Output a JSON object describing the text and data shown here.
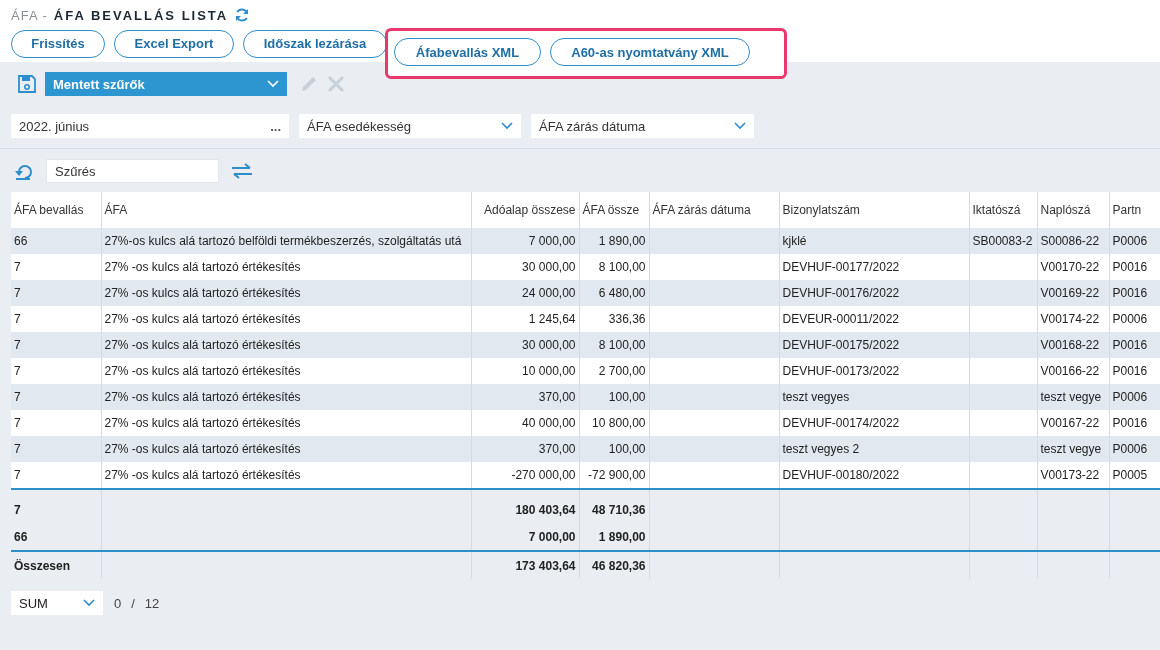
{
  "header": {
    "breadcrumb": "ÁFA -",
    "title": "ÁFA BEVALLÁS LISTA"
  },
  "toolbar": [
    {
      "label": "Frissítés",
      "highlighted": false
    },
    {
      "label": "Excel Export",
      "highlighted": false
    },
    {
      "label": "Időszak lezárása",
      "highlighted": false
    },
    {
      "label": "Áfabevallás XML",
      "highlighted": true
    },
    {
      "label": "A60-as nyomtatvány XML",
      "highlighted": true
    }
  ],
  "saved_filters": {
    "value": "Mentett szűrők"
  },
  "filters": [
    {
      "kind": "period",
      "value": "2022. június",
      "button": "..."
    },
    {
      "kind": "select",
      "value": "ÁFA esedékesség"
    },
    {
      "kind": "select",
      "value": "ÁFA zárás dátuma"
    }
  ],
  "search": {
    "placeholder": "Szűrés"
  },
  "table": {
    "columns": [
      "ÁFA bevallás",
      "ÁFA",
      "Adóalap összese",
      "ÁFA össze",
      "ÁFA zárás dátuma",
      "Bizonylatszám",
      "Iktatószá",
      "Naplószá",
      "Partn"
    ],
    "rows": [
      [
        "66",
        "27%-os kulcs alá tartozó belföldi termékbeszerzés, szolgáltatás utá",
        "7 000,00",
        "1 890,00",
        "",
        "kjklé",
        "SB00083-2",
        "S00086-22",
        "P0006"
      ],
      [
        "7",
        "27% -os kulcs alá tartozó értékesítés",
        "30 000,00",
        "8 100,00",
        "",
        "DEVHUF-00177/2022",
        "",
        "V00170-22",
        "P0016"
      ],
      [
        "7",
        "27% -os kulcs alá tartozó értékesítés",
        "24 000,00",
        "6 480,00",
        "",
        "DEVHUF-00176/2022",
        "",
        "V00169-22",
        "P0016"
      ],
      [
        "7",
        "27% -os kulcs alá tartozó értékesítés",
        "1 245,64",
        "336,36",
        "",
        "DEVEUR-00011/2022",
        "",
        "V00174-22",
        "P0006"
      ],
      [
        "7",
        "27% -os kulcs alá tartozó értékesítés",
        "30 000,00",
        "8 100,00",
        "",
        "DEVHUF-00175/2022",
        "",
        "V00168-22",
        "P0016"
      ],
      [
        "7",
        "27% -os kulcs alá tartozó értékesítés",
        "10 000,00",
        "2 700,00",
        "",
        "DEVHUF-00173/2022",
        "",
        "V00166-22",
        "P0016"
      ],
      [
        "7",
        "27% -os kulcs alá tartozó értékesítés",
        "370,00",
        "100,00",
        "",
        "teszt vegyes",
        "",
        "teszt vegye",
        "P0006"
      ],
      [
        "7",
        "27% -os kulcs alá tartozó értékesítés",
        "40 000,00",
        "10 800,00",
        "",
        "DEVHUF-00174/2022",
        "",
        "V00167-22",
        "P0016"
      ],
      [
        "7",
        "27% -os kulcs alá tartozó értékesítés",
        "370,00",
        "100,00",
        "",
        "teszt vegyes 2",
        "",
        "teszt vegye",
        "P0006"
      ],
      [
        "7",
        "27% -os kulcs alá tartozó értékesítés",
        "-270 000,00",
        "-72 900,00",
        "",
        "DEVHUF-00180/2022",
        "",
        "V00173-22",
        "P0005"
      ]
    ],
    "group_rows": [
      {
        "label": "7",
        "base": "180 403,64",
        "vat": "48 710,36"
      },
      {
        "label": "66",
        "base": "7 000,00",
        "vat": "1 890,00"
      }
    ],
    "total_row": {
      "label": "Összesen",
      "base": "173 403,64",
      "vat": "46 820,36"
    }
  },
  "pager": {
    "aggregate": "SUM",
    "count": "0",
    "separator": "/",
    "total": "12"
  }
}
